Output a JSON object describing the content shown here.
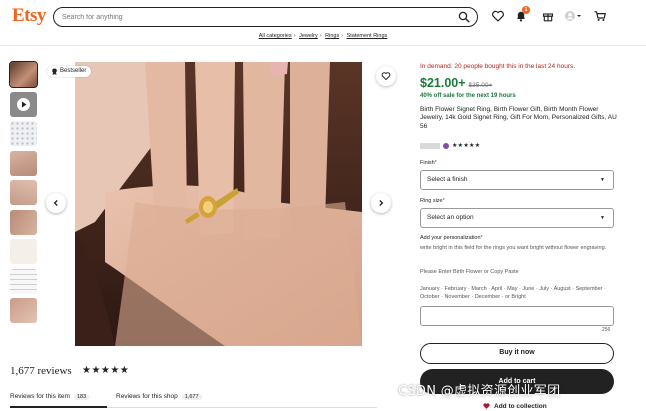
{
  "header": {
    "logo": "Etsy",
    "search_placeholder": "Search for anything",
    "cart_badge": "1",
    "icons": [
      "search-icon",
      "heart-icon",
      "bell-icon",
      "gift-icon",
      "avatar",
      "cart-icon"
    ]
  },
  "breadcrumb": [
    "All categories",
    "Jewelry",
    "Rings",
    "Statement Rings"
  ],
  "gallery": {
    "badge": "Bestseller",
    "thumbnails": 9
  },
  "reviews": {
    "count_text": "1,677 reviews",
    "stars": "★★★★★",
    "tabs": [
      {
        "label": "Reviews for this item",
        "count": "183"
      },
      {
        "label": "Reviews for this shop",
        "count": "1,677"
      }
    ]
  },
  "listing": {
    "demand": "In demand. 20 people bought this in the last 24 hours.",
    "price": "$21.00+",
    "original_price": "$35.00+",
    "sale_text": "40% off sale for the next 19 hours",
    "title": "Birth Flower Signet Ring, Birth Flower Gift, Birth Month Flower Jewelry, 14k Gold Signet Ring, Gift For Mom, Personalized Gifts, AU 56",
    "shop_stars": "★★★★★",
    "finish": {
      "label": "Finish",
      "required": "*",
      "value": "Select a finish"
    },
    "ring_size": {
      "label": "Ring size",
      "required": "*",
      "value": "Select an option"
    },
    "personalization": {
      "label": "Add your personalization",
      "required": "*",
      "hint": "write bright in this field for the rings you want bright without flower engraving.",
      "instruction": "Please Enter Birth Flower or Copy Paste",
      "months": "January · February · March · April · May · June · July · August · September · October · November · December · or Bright",
      "char_count": "256"
    },
    "buy_now": "Buy it now",
    "add_to_cart": "Add to cart",
    "add_to_collection": "Add to collection"
  },
  "watermark": "CSDN @虚拟资源创业军团",
  "colors": {
    "brand": "#f1641e",
    "demand": "#b3261e",
    "price": "#1a7a3a",
    "primary_button": "#222222"
  }
}
